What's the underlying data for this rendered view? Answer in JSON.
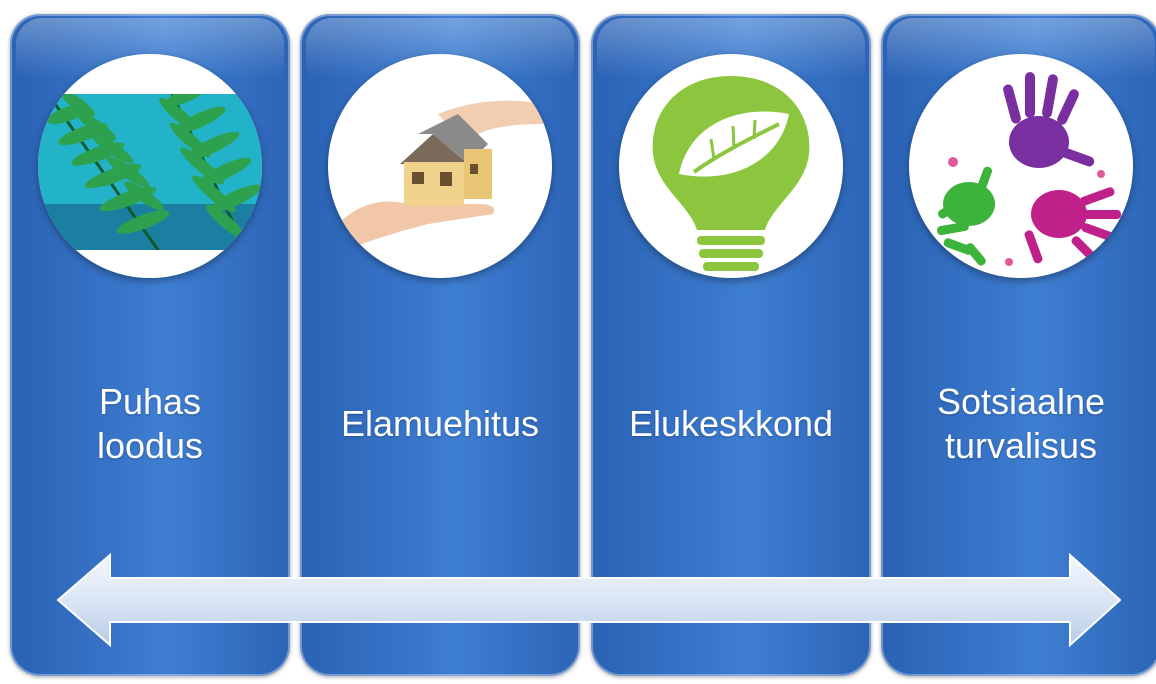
{
  "panels": [
    {
      "line1": "Puhas",
      "line2": "loodus",
      "icon": "fern-icon"
    },
    {
      "line1": "Elamuehitus",
      "line2": "",
      "icon": "house-in-hand-icon"
    },
    {
      "line1": "Elukeskkond",
      "line2": "",
      "icon": "green-lightbulb-leaf-icon"
    },
    {
      "line1": "Sotsiaalne",
      "line2": "turvalisus",
      "icon": "colorful-handprints-icon"
    }
  ],
  "colors": {
    "panel_blue": "#3a78cc",
    "arrow_fill": "#dbe6f5",
    "bulb_green": "#8cc63f",
    "fern_green": "#1f7a3c"
  }
}
